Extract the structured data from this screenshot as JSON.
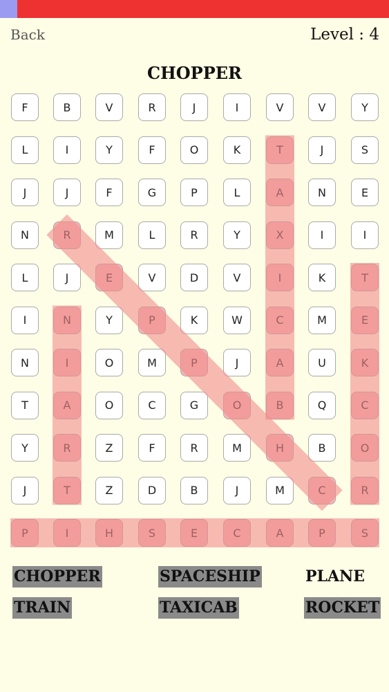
{
  "header": {
    "back_label": "Back",
    "level_label": "Level : 4",
    "current_word": "CHOPPER",
    "timer_progress": 0.045,
    "timer_color": "#ee3131",
    "timer_progress_color": "#9b9bf2"
  },
  "grid": [
    [
      "F",
      "B",
      "V",
      "R",
      "J",
      "I",
      "V",
      "V",
      "Y"
    ],
    [
      "L",
      "I",
      "Y",
      "F",
      "O",
      "K",
      "T",
      "J",
      "S"
    ],
    [
      "J",
      "J",
      "F",
      "G",
      "P",
      "L",
      "A",
      "N",
      "E"
    ],
    [
      "N",
      "R",
      "M",
      "L",
      "R",
      "Y",
      "X",
      "I",
      "I"
    ],
    [
      "L",
      "J",
      "E",
      "V",
      "D",
      "V",
      "I",
      "K",
      "T"
    ],
    [
      "I",
      "N",
      "Y",
      "P",
      "K",
      "W",
      "C",
      "M",
      "E"
    ],
    [
      "N",
      "I",
      "O",
      "M",
      "P",
      "J",
      "A",
      "U",
      "K"
    ],
    [
      "T",
      "A",
      "O",
      "C",
      "G",
      "O",
      "B",
      "Q",
      "C"
    ],
    [
      "Y",
      "R",
      "Z",
      "F",
      "R",
      "M",
      "H",
      "B",
      "O"
    ],
    [
      "J",
      "T",
      "Z",
      "D",
      "B",
      "J",
      "M",
      "C",
      "R"
    ],
    [
      "P",
      "I",
      "H",
      "S",
      "E",
      "C",
      "A",
      "P",
      "S"
    ]
  ],
  "found_words": [
    {
      "word": "TAXICAB",
      "start": [
        1,
        6
      ],
      "end": [
        7,
        6
      ]
    },
    {
      "word": "ROCKET",
      "start": [
        9,
        8
      ],
      "end": [
        4,
        8
      ]
    },
    {
      "word": "TRAIN",
      "start": [
        9,
        1
      ],
      "end": [
        5,
        1
      ]
    },
    {
      "word": "SPACESHIP",
      "start": [
        10,
        8
      ],
      "end": [
        10,
        0
      ]
    },
    {
      "word": "CHOPPER",
      "start": [
        9,
        7
      ],
      "end": [
        3,
        1
      ]
    }
  ],
  "highlight_color": "#f08c8c",
  "word_list": [
    {
      "label": "CHOPPER",
      "found": true
    },
    {
      "label": "SPACESHIP",
      "found": true
    },
    {
      "label": "PLANE",
      "found": false
    },
    {
      "label": "TRAIN",
      "found": true
    },
    {
      "label": "TAXICAB",
      "found": true
    },
    {
      "label": "ROCKET",
      "found": true
    }
  ]
}
